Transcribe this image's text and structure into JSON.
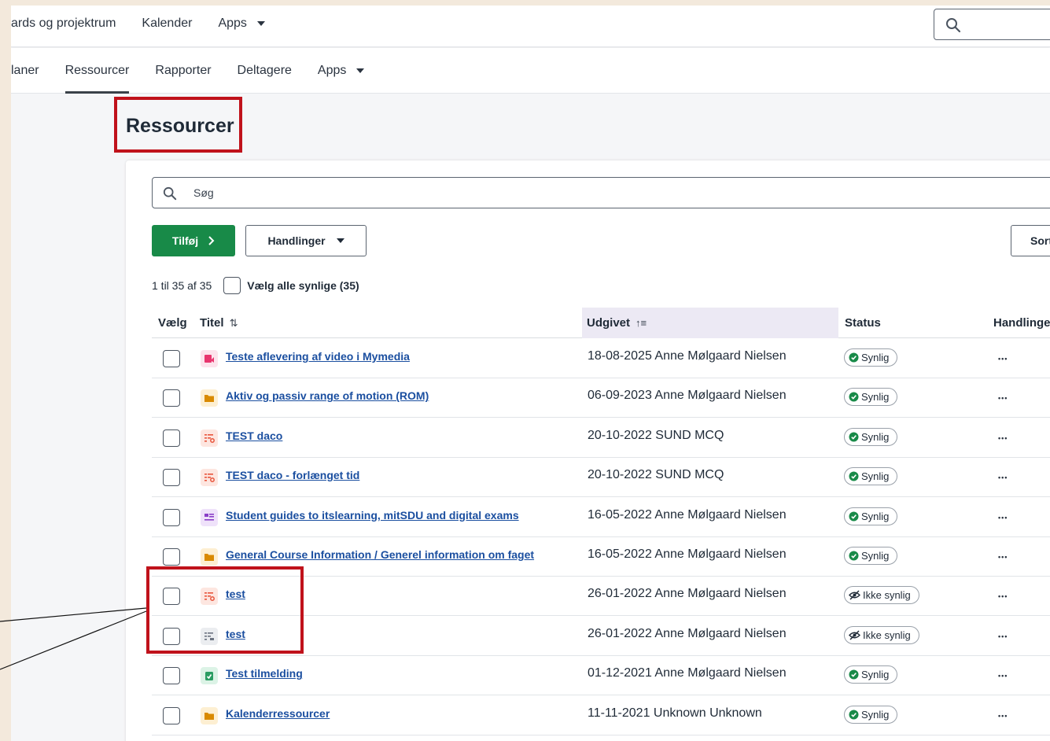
{
  "top_nav": {
    "items": [
      "ards og projektrum",
      "Kalender",
      "Apps"
    ]
  },
  "sub_nav": {
    "items": [
      "laner",
      "Ressourcer",
      "Rapporter",
      "Deltagere",
      "Apps"
    ],
    "active": "Ressourcer"
  },
  "page": {
    "title": "Ressourcer"
  },
  "search": {
    "placeholder": "Søg"
  },
  "toolbar": {
    "add_label": "Tilføj",
    "actions_label": "Handlinger",
    "sort_label": "Sort"
  },
  "list": {
    "count_text": "1 til 35 af 35",
    "select_all_label": "Vælg alle synlige (35)",
    "columns": {
      "select": "Vælg",
      "title": "Titel",
      "published": "Udgivet",
      "status": "Status",
      "actions": "Handlinge"
    },
    "rows": [
      {
        "title": "Teste aflevering af video i Mymedia",
        "published": "18-08-2025 Anne Mølgaard Nielsen",
        "status": "Synlig",
        "visible": true,
        "icon": "video-assignment-icon",
        "icon_color": "#e8356e",
        "icon_bg": "#fde3ec"
      },
      {
        "title": "Aktiv og passiv range of motion (ROM)",
        "published": "06-09-2023 Anne Mølgaard Nielsen",
        "status": "Synlig",
        "visible": true,
        "icon": "folder-icon",
        "icon_color": "#d98a00",
        "icon_bg": "#fdefd2"
      },
      {
        "title": "TEST daco",
        "published": "20-10-2022 SUND MCQ",
        "status": "Synlig",
        "visible": true,
        "icon": "test-icon",
        "icon_color": "#e8553c",
        "icon_bg": "#fde6e0"
      },
      {
        "title": "TEST daco - forlænget tid",
        "published": "20-10-2022 SUND MCQ",
        "status": "Synlig",
        "visible": true,
        "icon": "test-icon",
        "icon_color": "#e8553c",
        "icon_bg": "#fde6e0"
      },
      {
        "title": "Student guides to itslearning, mitSDU and digital exams",
        "published": "16-05-2022 Anne Mølgaard Nielsen",
        "status": "Synlig",
        "visible": true,
        "icon": "page-icon",
        "icon_color": "#8a3fc7",
        "icon_bg": "#efe2fa"
      },
      {
        "title": "General Course Information / Generel information om faget",
        "published": "16-05-2022 Anne Mølgaard Nielsen",
        "status": "Synlig",
        "visible": true,
        "icon": "folder-icon",
        "icon_color": "#d98a00",
        "icon_bg": "#fdefd2"
      },
      {
        "title": "test",
        "published": "26-01-2022 Anne Mølgaard Nielsen",
        "status": "Ikke synlig",
        "visible": false,
        "icon": "test-icon",
        "icon_color": "#e8553c",
        "icon_bg": "#fde6e0"
      },
      {
        "title": "test",
        "published": "26-01-2022 Anne Mølgaard Nielsen",
        "status": "Ikke synlig",
        "visible": false,
        "icon": "survey-icon",
        "icon_color": "#6b7280",
        "icon_bg": "#ebedf0"
      },
      {
        "title": "Test tilmelding",
        "published": "01-12-2021 Anne Mølgaard Nielsen",
        "status": "Synlig",
        "visible": true,
        "icon": "registration-icon",
        "icon_color": "#2a9d62",
        "icon_bg": "#dcf3e6"
      },
      {
        "title": "Kalenderressourcer",
        "published": "11-11-2021 Unknown Unknown",
        "status": "Synlig",
        "visible": true,
        "icon": "folder-icon",
        "icon_color": "#d98a00",
        "icon_bg": "#fdefd2"
      }
    ]
  },
  "colors": {
    "highlight": "#c0121b",
    "link": "#1b4fa0",
    "primary_button": "#188a48",
    "visible_status": "#188a48"
  }
}
